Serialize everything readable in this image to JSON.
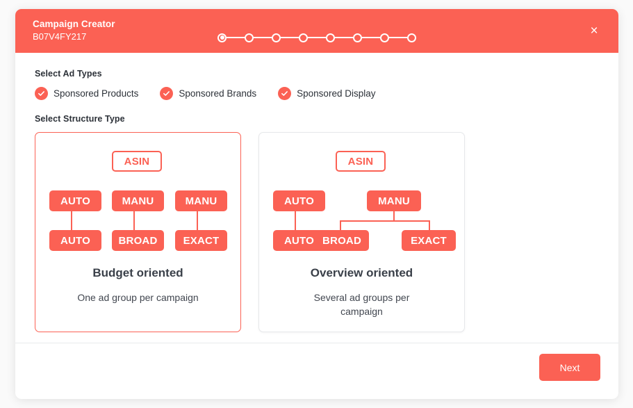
{
  "theme": {
    "accent": "#fb6154",
    "text_dark": "#2c3138",
    "card_border_unselected": "#e6e8ea",
    "page_background": "#fafafa"
  },
  "header": {
    "title": "Campaign Creator",
    "subtitle": "B07V4FY217",
    "close_label": "×",
    "stepper": {
      "total": 8,
      "active_index": 1,
      "dots": [
        {
          "state": "active"
        },
        {
          "state": "inactive"
        },
        {
          "state": "inactive"
        },
        {
          "state": "inactive"
        },
        {
          "state": "inactive"
        },
        {
          "state": "inactive"
        },
        {
          "state": "inactive"
        },
        {
          "state": "inactive"
        }
      ]
    }
  },
  "ad_types": {
    "section_label": "Select Ad Types",
    "items": [
      {
        "label": "Sponsored Products",
        "checked": true,
        "icon": "check-circle-icon"
      },
      {
        "label": "Sponsored Brands",
        "checked": true,
        "icon": "check-circle-icon"
      },
      {
        "label": "Sponsored Display",
        "checked": true,
        "icon": "check-circle-icon"
      }
    ]
  },
  "structure": {
    "section_label": "Select Structure Type",
    "cards": [
      {
        "id": "budget-oriented",
        "selected": true,
        "title": "Budget oriented",
        "description": "One ad group per campaign",
        "nodes": [
          {
            "label": "ASIN",
            "style": "outline"
          },
          {
            "label": "AUTO",
            "style": "filled"
          },
          {
            "label": "MANU",
            "style": "filled"
          },
          {
            "label": "MANU",
            "style": "filled"
          },
          {
            "label": "AUTO",
            "style": "filled"
          },
          {
            "label": "BROAD",
            "style": "filled"
          },
          {
            "label": "EXACT",
            "style": "filled"
          }
        ]
      },
      {
        "id": "overview-oriented",
        "selected": false,
        "title": "Overview oriented",
        "description": "Several ad groups per campaign",
        "nodes": [
          {
            "label": "ASIN",
            "style": "outline"
          },
          {
            "label": "AUTO",
            "style": "filled"
          },
          {
            "label": "MANU",
            "style": "filled"
          },
          {
            "label": "AUTO",
            "style": "filled"
          },
          {
            "label": "BROAD",
            "style": "filled"
          },
          {
            "label": "EXACT",
            "style": "filled"
          }
        ]
      }
    ]
  },
  "footer": {
    "next_label": "Next"
  }
}
